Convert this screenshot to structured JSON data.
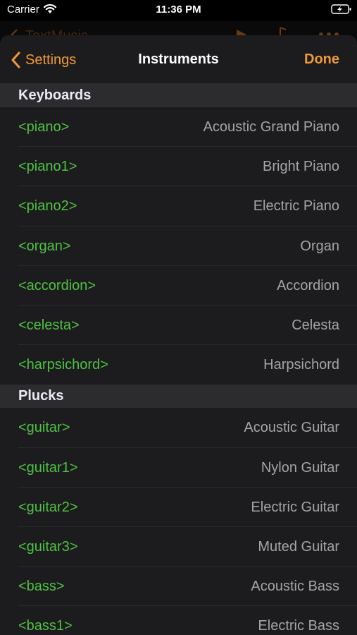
{
  "status_bar": {
    "carrier": "Carrier",
    "time": "11:36 PM",
    "wifi_icon": "wifi-icon",
    "battery_icon": "battery-charging-icon"
  },
  "background_page": {
    "title": "TextMusic"
  },
  "navbar": {
    "back_label": "Settings",
    "title": "Instruments",
    "done_label": "Done"
  },
  "colors": {
    "accent": "#f09a37",
    "tag": "#4fc142",
    "name": "#a4a4a9",
    "sheet_bg": "#1c1c1e",
    "section_bg": "#2c2c2e"
  },
  "sections": [
    {
      "title": "Keyboards",
      "rows": [
        {
          "tag": "<piano>",
          "name": "Acoustic Grand Piano"
        },
        {
          "tag": "<piano1>",
          "name": "Bright Piano"
        },
        {
          "tag": "<piano2>",
          "name": "Electric Piano"
        },
        {
          "tag": "<organ>",
          "name": "Organ"
        },
        {
          "tag": "<accordion>",
          "name": "Accordion"
        },
        {
          "tag": "<celesta>",
          "name": "Celesta"
        },
        {
          "tag": "<harpsichord>",
          "name": "Harpsichord"
        }
      ]
    },
    {
      "title": "Plucks",
      "rows": [
        {
          "tag": "<guitar>",
          "name": "Acoustic Guitar"
        },
        {
          "tag": "<guitar1>",
          "name": "Nylon Guitar"
        },
        {
          "tag": "<guitar2>",
          "name": "Electric Guitar"
        },
        {
          "tag": "<guitar3>",
          "name": "Muted Guitar"
        },
        {
          "tag": "<bass>",
          "name": "Acoustic Bass"
        },
        {
          "tag": "<bass1>",
          "name": "Electric Bass"
        }
      ]
    }
  ]
}
